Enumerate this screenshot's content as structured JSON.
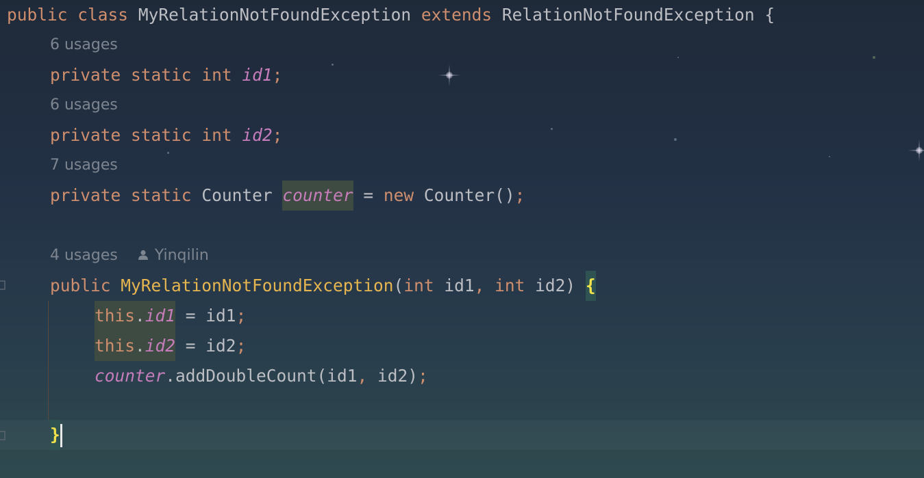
{
  "code": {
    "class_decl": {
      "kw_public": "public",
      "kw_class": "class",
      "class_name": "MyRelationNotFoundException",
      "kw_extends": "extends",
      "super_name": "RelationNotFoundException",
      "open_brace": "{"
    },
    "hint_id1": "6 usages",
    "field_id1": {
      "kw_private": "private",
      "kw_static": "static",
      "kw_type": "int",
      "name": "id1",
      "semi": ";"
    },
    "hint_id2": "6 usages",
    "field_id2": {
      "kw_private": "private",
      "kw_static": "static",
      "kw_type": "int",
      "name": "id2",
      "semi": ";"
    },
    "hint_counter": "7 usages",
    "field_counter": {
      "kw_private": "private",
      "kw_static": "static",
      "type": "Counter",
      "name": "counter",
      "assign": " = ",
      "kw_new": "new",
      "ctor": "Counter()",
      "semi": ";"
    },
    "hint_ctor": "4 usages",
    "hint_author": "Yinqilin",
    "ctor_decl": {
      "kw_public": "public",
      "name": "MyRelationNotFoundException",
      "open_paren": "(",
      "kw_int1": "int",
      "p1": " id1",
      "comma1": ",",
      "kw_int2": "int",
      "p2": " id2",
      "close_paren": ") ",
      "open_brace": "{"
    },
    "assign1": {
      "kw_this": "this",
      "dot": ".",
      "field": "id1",
      "rest": " = id1",
      "semi": ";"
    },
    "assign2": {
      "kw_this": "this",
      "dot": ".",
      "field": "id2",
      "rest": " = id2",
      "semi": ";"
    },
    "call": {
      "obj": "counter",
      "method": ".addDoubleCount(id1",
      "comma": ",",
      "args": " id2)",
      "semi": ";"
    },
    "close_brace": "}"
  },
  "colors": {
    "keyword": "#cf8e6d",
    "field": "#c77dbb",
    "function": "#e6b550",
    "plain": "#bcbec4",
    "hint": "#7d8590",
    "brace_match": "#f0e24b"
  },
  "icons": [
    "person-icon",
    "gutter-override-icon",
    "gutter-fold-icon"
  ]
}
